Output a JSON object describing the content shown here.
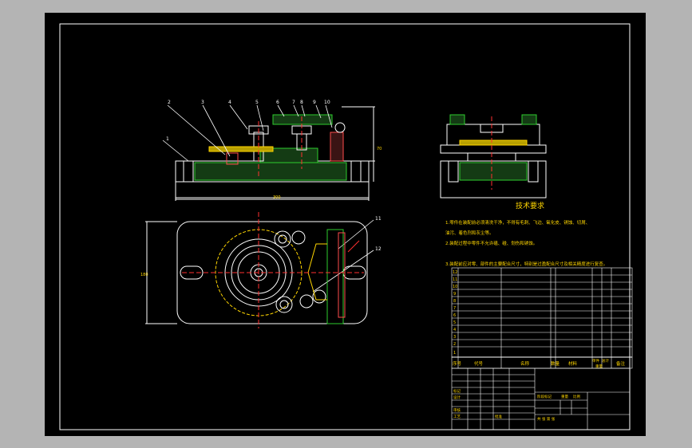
{
  "drawing": {
    "balloons": [
      "1",
      "2",
      "3",
      "4",
      "5",
      "6",
      "7",
      "8",
      "9",
      "10",
      "11",
      "12"
    ],
    "dims": {
      "overall_length": "300",
      "overall_height": "70",
      "plan_width": "180"
    },
    "tech_req": {
      "title": "技术要求",
      "lines": [
        "1.零件在装配前必须清洗干净，不得有毛刺、飞边、氧化皮、锈蚀、切屑、",
        "油污、着色剂和灰尘等。",
        "2.装配过程中零件不允许磕、碰、划伤和锈蚀。",
        "3.装配前应对零、部件的主要配合尺寸，特别是过盈配合尺寸及相关精度进行复查。"
      ]
    },
    "bom_rows": [
      "12",
      "11",
      "10",
      "9",
      "8",
      "7",
      "6",
      "5",
      "4",
      "3",
      "2",
      "1"
    ],
    "bom_header": {
      "no": "序号",
      "code": "代号",
      "name": "名称",
      "qty": "数量",
      "material": "材料",
      "single": "单件",
      "total": "总计",
      "weight": "重量",
      "remark": "备注"
    },
    "title_block": {
      "scale": "比例",
      "sheet": "共 张 第 张",
      "design": "设计",
      "check": "审核",
      "process": "工艺",
      "approve": "批准",
      "mark": "标记",
      "stage": "阶段标记",
      "weight": "重量"
    }
  }
}
